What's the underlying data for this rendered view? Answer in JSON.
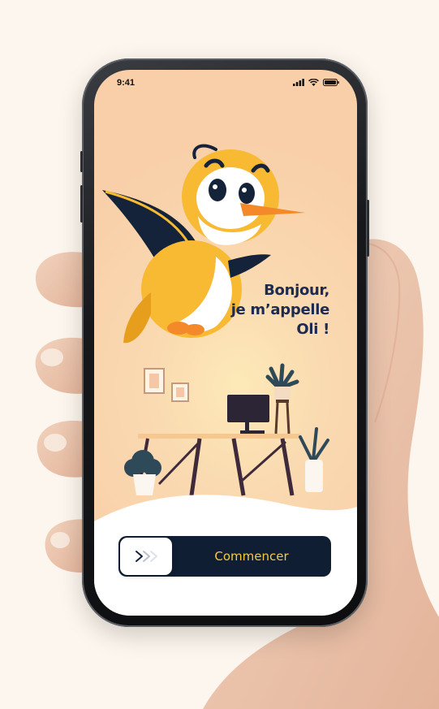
{
  "status_bar": {
    "time": "9:41",
    "icons": [
      "signal-icon",
      "wifi-icon",
      "battery-icon"
    ]
  },
  "greeting": {
    "line1": "Bonjour,",
    "line2": "je m’appelle",
    "line3": "Oli !"
  },
  "cta": {
    "label": "Commencer",
    "knob_icon": "double-chevron-right-icon"
  },
  "colors": {
    "background": "#fcf6ee",
    "screen_peach": "#f8cfa9",
    "greeting_text": "#1c2b4f",
    "cta_background": "#0f1e33",
    "cta_label": "#f7c843",
    "bird_yellow": "#f8b933",
    "bird_dark": "#142339",
    "beak_orange": "#f4892a"
  }
}
